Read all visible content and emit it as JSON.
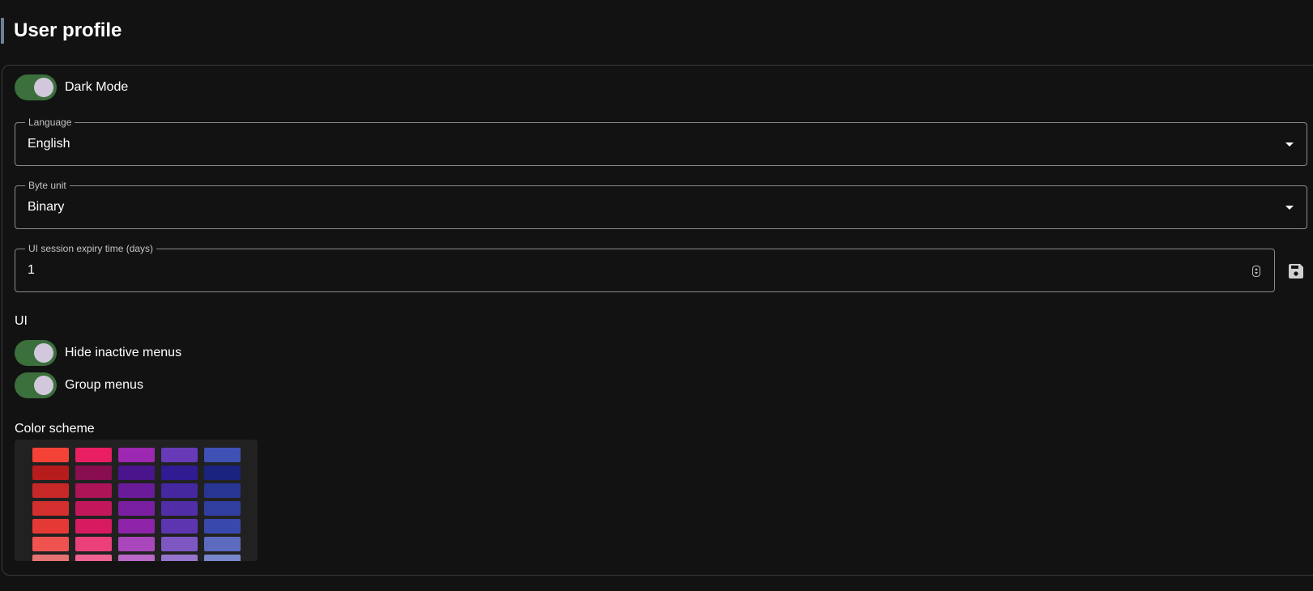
{
  "page": {
    "title": "User profile"
  },
  "settings": {
    "dark_mode": {
      "label": "Dark Mode",
      "checked": true
    },
    "language": {
      "label": "Language",
      "value": "English"
    },
    "byte_unit": {
      "label": "Byte unit",
      "value": "Binary"
    },
    "session_expiry": {
      "label": "UI session expiry time (days)",
      "value": "1"
    }
  },
  "ui_section": {
    "heading": "UI",
    "hide_inactive_menus": {
      "label": "Hide inactive menus",
      "checked": true
    },
    "group_menus": {
      "label": "Group menus",
      "checked": true
    }
  },
  "color_scheme": {
    "heading": "Color scheme",
    "swatch_rows": [
      [
        "#f44336",
        "#e91e63",
        "#9c27b0",
        "#673ab7",
        "#3f51b5"
      ],
      [
        "#b71c1c",
        "#880e4f",
        "#4a148c",
        "#311b92",
        "#1a237e"
      ],
      [
        "#c62828",
        "#ad1457",
        "#6a1b9a",
        "#4527a0",
        "#283593"
      ],
      [
        "#d32f2f",
        "#c2185b",
        "#7b1fa2",
        "#512da8",
        "#303f9f"
      ],
      [
        "#e53935",
        "#d81b60",
        "#8e24aa",
        "#5e35b1",
        "#3949ab"
      ],
      [
        "#ef5350",
        "#ec407a",
        "#ab47bc",
        "#7e57c2",
        "#5c6bc0"
      ],
      [
        "#e57373",
        "#f06292",
        "#ba68c8",
        "#9575cd",
        "#7986cb"
      ]
    ]
  },
  "colors": {
    "background": "#121212",
    "switch_on": "#3b6f3c",
    "switch_knob": "#d2c8dc",
    "accent_bar": "#6d8296"
  },
  "icons": {
    "save": "save-icon",
    "dropdown": "arrow-drop-down-icon",
    "spinner": "number-spinner-icon"
  }
}
